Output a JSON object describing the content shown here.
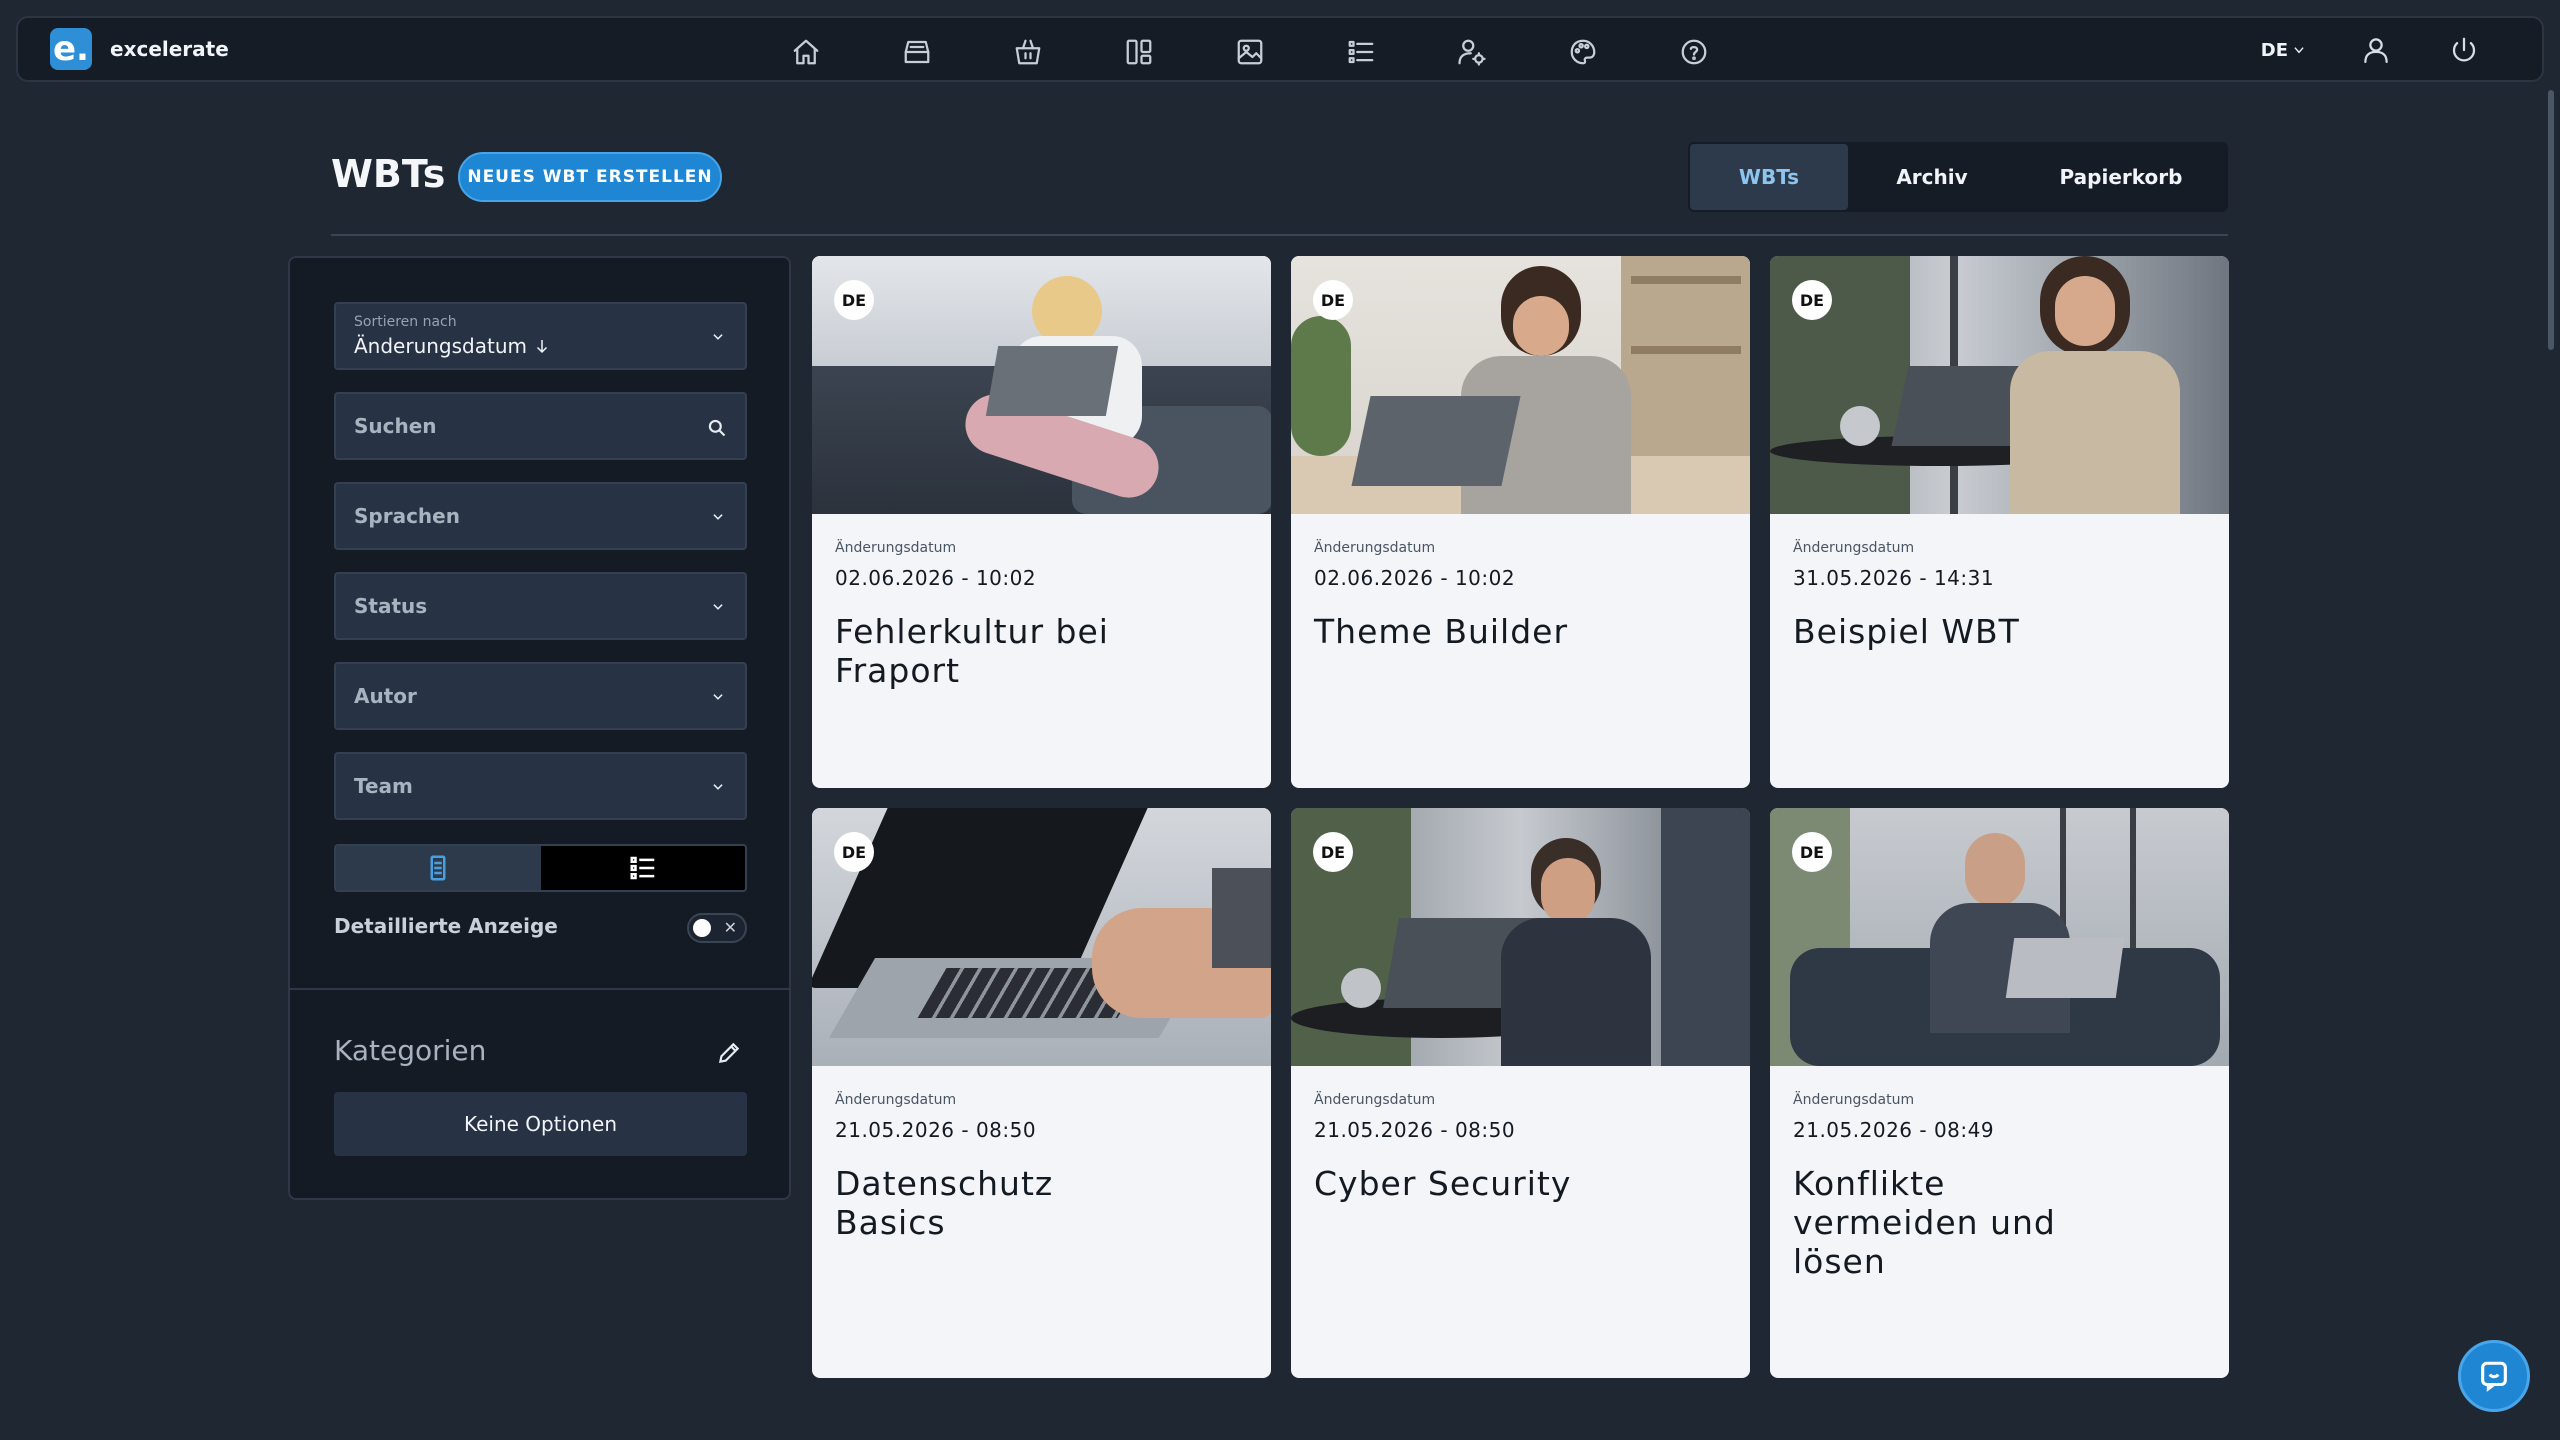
{
  "brand": {
    "logo_letter": "e.",
    "name": "excelerate"
  },
  "nav": {
    "icons": [
      "home-icon",
      "inbox-tray-icon",
      "basket-icon",
      "layout-columns-icon",
      "image-gallery-icon",
      "list-icon",
      "user-settings-icon",
      "palette-icon",
      "help-icon"
    ],
    "language": "DE",
    "right_icons": [
      "user-icon",
      "power-icon"
    ]
  },
  "header": {
    "title": "WBTs",
    "create_button": "NEUES WBT ERSTELLEN",
    "tabs": [
      {
        "label": "WBTs",
        "active": true
      },
      {
        "label": "Archiv",
        "active": false
      },
      {
        "label": "Papierkorb",
        "active": false
      }
    ]
  },
  "sidebar": {
    "sort": {
      "label": "Sortieren nach",
      "value": "Änderungsdatum"
    },
    "search_placeholder": "Suchen",
    "filters": [
      "Sprachen",
      "Status",
      "Autor",
      "Team"
    ],
    "view_mode": "grid",
    "detail_label": "Detaillierte Anzeige",
    "detail_enabled": false,
    "categories_title": "Kategorien",
    "no_options": "Keine Optionen"
  },
  "cards": [
    {
      "lang": "DE",
      "date_label": "Änderungsdatum",
      "date": "02.06.2026 - 10:02",
      "title": "Fehlerkultur bei Fraport"
    },
    {
      "lang": "DE",
      "date_label": "Änderungsdatum",
      "date": "02.06.2026 - 10:02",
      "title": "Theme Builder"
    },
    {
      "lang": "DE",
      "date_label": "Änderungsdatum",
      "date": "31.05.2026 - 14:31",
      "title": "Beispiel WBT"
    },
    {
      "lang": "DE",
      "date_label": "Änderungsdatum",
      "date": "21.05.2026 - 08:50",
      "title": "Datenschutz Basics"
    },
    {
      "lang": "DE",
      "date_label": "Änderungsdatum",
      "date": "21.05.2026 - 08:50",
      "title": "Cyber Security"
    },
    {
      "lang": "DE",
      "date_label": "Änderungsdatum",
      "date": "21.05.2026 - 08:49",
      "title": "Konflikte vermeiden und lösen"
    }
  ],
  "colors": {
    "background": "#1f2733",
    "accent": "#1f86d3",
    "panel": "#141b25",
    "card": "#f3f5f9"
  }
}
